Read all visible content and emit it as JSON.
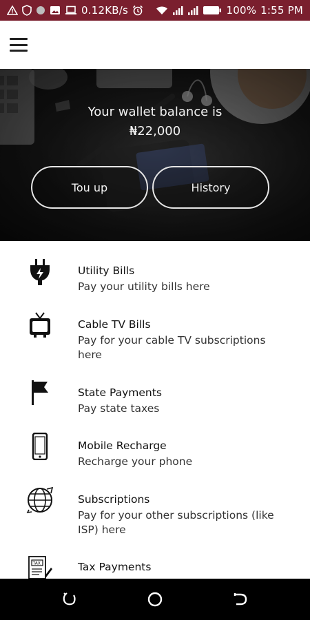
{
  "status_bar": {
    "speed": "0.12KB/s",
    "battery": "100%",
    "time": "1:55 PM",
    "background": "#7a1f2e",
    "icons": [
      "warning-icon",
      "shield-icon",
      "dot-icon",
      "image-icon",
      "laptop-icon",
      "alarm-icon",
      "wifi-icon",
      "signal-icon",
      "signal-icon",
      "battery-icon"
    ]
  },
  "app_bar": {
    "menu_icon": "hamburger-menu-icon"
  },
  "hero": {
    "title": "Your wallet balance is",
    "balance": "₦22,000",
    "topup_label": "Tou up",
    "history_label": "History"
  },
  "services": [
    {
      "title": "Utility Bills",
      "subtitle": "Pay your utility bills here",
      "icon": "power-plug-icon"
    },
    {
      "title": "Cable TV Bills",
      "subtitle": "Pay for your cable TV subscriptions here",
      "icon": "tv-icon"
    },
    {
      "title": "State Payments",
      "subtitle": "Pay state taxes",
      "icon": "flag-icon"
    },
    {
      "title": "Mobile Recharge",
      "subtitle": "Recharge your phone",
      "icon": "mobile-phone-icon"
    },
    {
      "title": "Subscriptions",
      "subtitle": "Pay for your other subscriptions (like ISP) here",
      "icon": "globe-icon"
    },
    {
      "title": "Tax Payments",
      "subtitle": "",
      "icon": "tax-document-icon"
    }
  ],
  "nav_bar": {
    "icons": [
      "recent-apps-icon",
      "home-icon",
      "back-icon"
    ]
  }
}
